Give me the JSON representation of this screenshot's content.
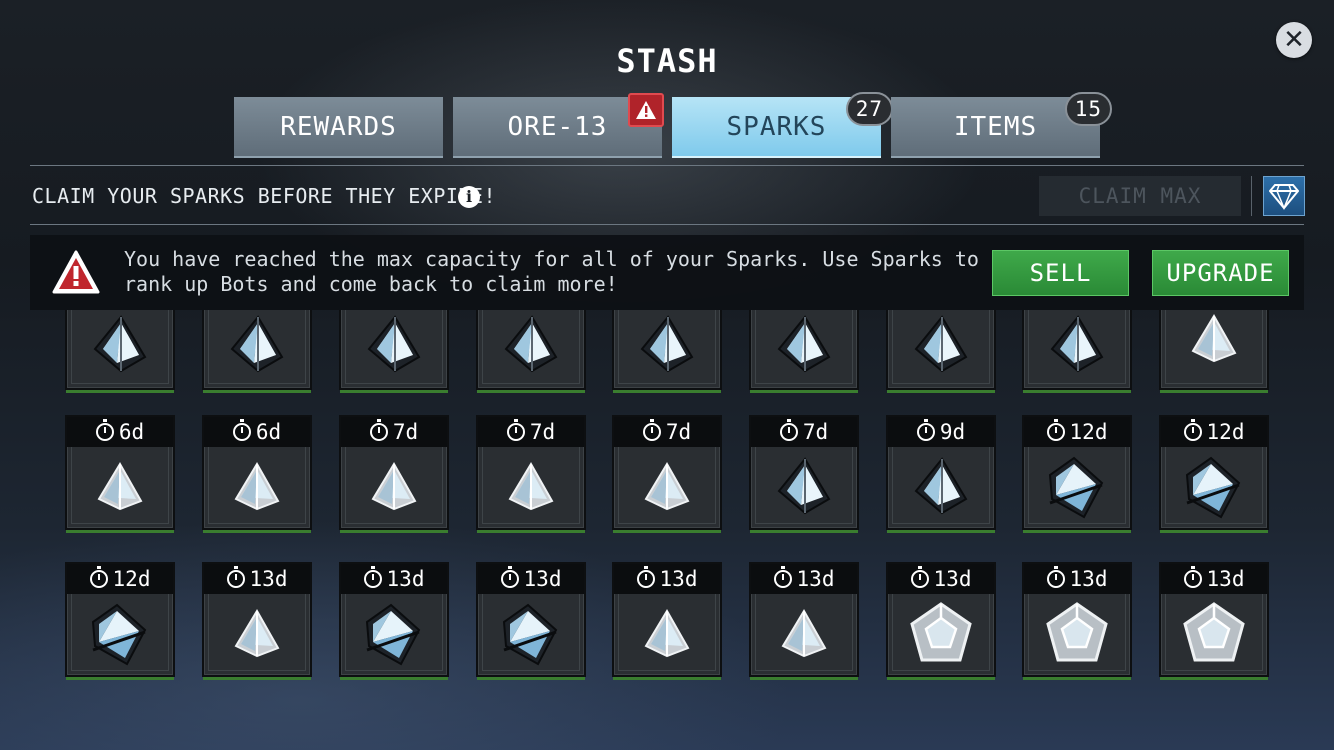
{
  "header": {
    "title": "STASH",
    "close_label": "✕"
  },
  "tabs": [
    {
      "label": "REWARDS",
      "badge": null,
      "warning": false,
      "active": false
    },
    {
      "label": "ORE-13",
      "badge": null,
      "warning": true,
      "active": false
    },
    {
      "label": "SPARKS",
      "badge": "27",
      "warning": false,
      "active": true
    },
    {
      "label": "ITEMS",
      "badge": "15",
      "warning": false,
      "active": false
    }
  ],
  "toolbar": {
    "subtitle": "CLAIM YOUR SPARKS BEFORE THEY EXPIRE!",
    "info_label": "i",
    "claim_max_label": "CLAIM MAX"
  },
  "banner": {
    "message": "You have reached the max capacity for all of your Sparks. Use Sparks to rank up Bots and come back to claim more!",
    "sell_label": "SELL",
    "upgrade_label": "UPGRADE"
  },
  "grid": {
    "rows": [
      {
        "items": [
          {
            "timer": "",
            "icon": "tetrahedron-dark-icon"
          },
          {
            "timer": "",
            "icon": "tetrahedron-dark-icon"
          },
          {
            "timer": "",
            "icon": "tetrahedron-dark-icon"
          },
          {
            "timer": "",
            "icon": "tetrahedron-dark-icon"
          },
          {
            "timer": "",
            "icon": "tetrahedron-dark-icon"
          },
          {
            "timer": "",
            "icon": "tetrahedron-dark-icon"
          },
          {
            "timer": "",
            "icon": "tetrahedron-dark-icon"
          },
          {
            "timer": "",
            "icon": "tetrahedron-dark-icon"
          },
          {
            "timer": "",
            "icon": "tetrahedron-silver-icon"
          }
        ]
      },
      {
        "items": [
          {
            "timer": "6d",
            "icon": "tetrahedron-silver-icon"
          },
          {
            "timer": "6d",
            "icon": "tetrahedron-silver-icon"
          },
          {
            "timer": "7d",
            "icon": "tetrahedron-silver-icon"
          },
          {
            "timer": "7d",
            "icon": "tetrahedron-silver-icon"
          },
          {
            "timer": "7d",
            "icon": "tetrahedron-silver-icon"
          },
          {
            "timer": "7d",
            "icon": "tetrahedron-dark-icon"
          },
          {
            "timer": "9d",
            "icon": "tetrahedron-dark-icon"
          },
          {
            "timer": "12d",
            "icon": "octahedron-dark-icon"
          },
          {
            "timer": "12d",
            "icon": "octahedron-dark-icon"
          }
        ]
      },
      {
        "items": [
          {
            "timer": "12d",
            "icon": "octahedron-dark-icon"
          },
          {
            "timer": "13d",
            "icon": "tetrahedron-silver-icon"
          },
          {
            "timer": "13d",
            "icon": "octahedron-dark-icon"
          },
          {
            "timer": "13d",
            "icon": "octahedron-dark-icon"
          },
          {
            "timer": "13d",
            "icon": "tetrahedron-silver-icon"
          },
          {
            "timer": "13d",
            "icon": "tetrahedron-silver-icon"
          },
          {
            "timer": "13d",
            "icon": "dodecahedron-silver-icon"
          },
          {
            "timer": "13d",
            "icon": "dodecahedron-silver-icon"
          },
          {
            "timer": "13d",
            "icon": "dodecahedron-silver-icon"
          }
        ]
      }
    ]
  },
  "colors": {
    "active_tab": "#8fd2f0",
    "button_green": "#2f9a3b",
    "warning_red": "#b0232a",
    "slot_rim_green": "#3a7d2f"
  }
}
